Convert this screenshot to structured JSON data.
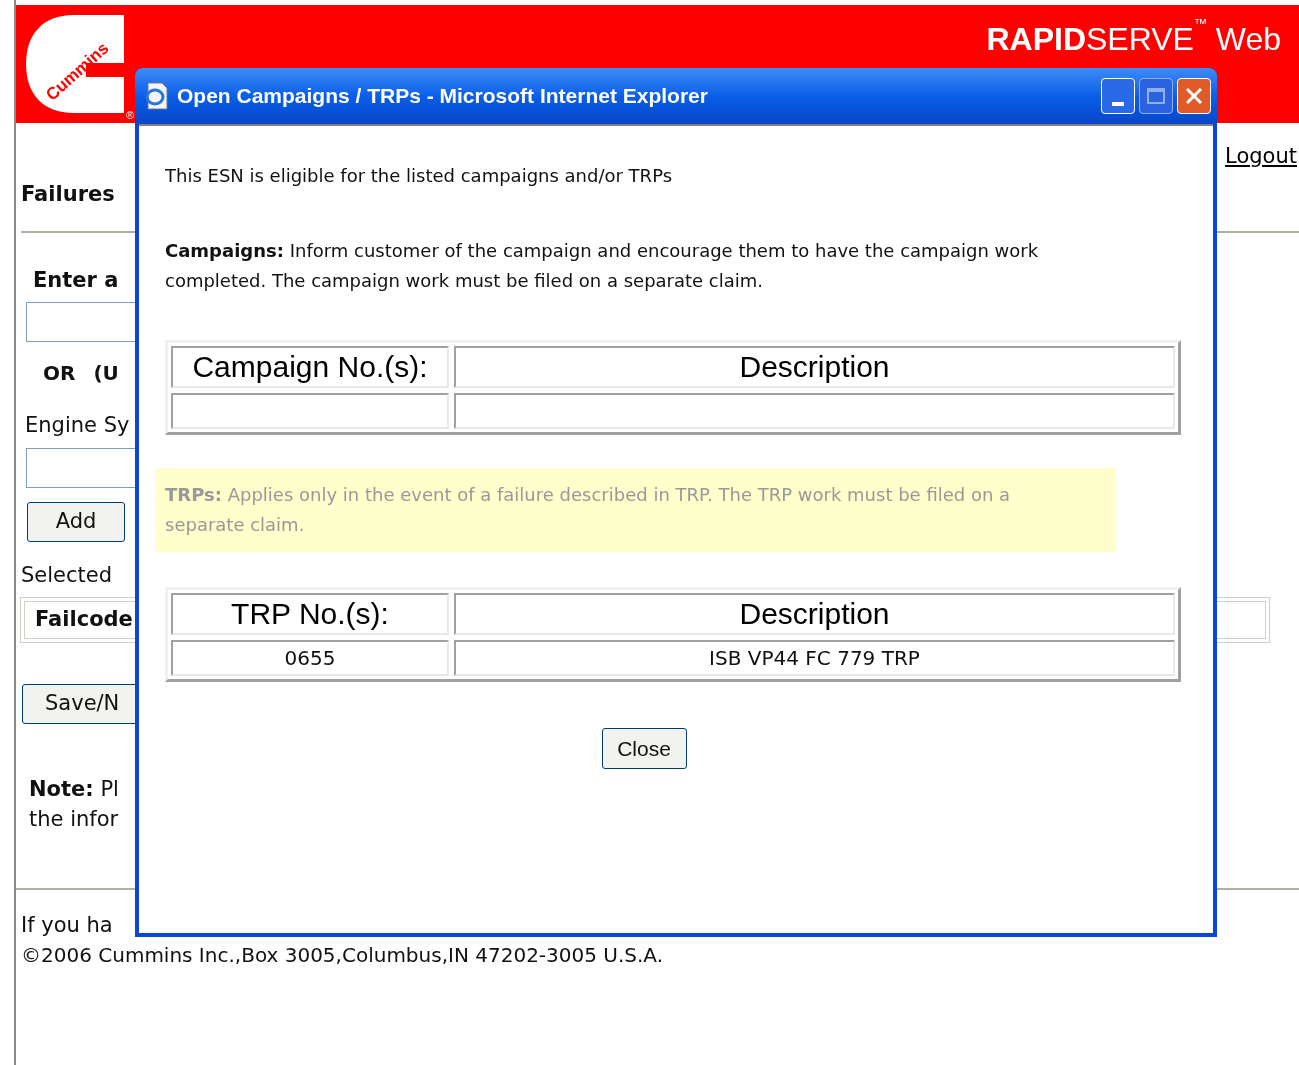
{
  "header": {
    "logo_text": "Cummins",
    "registered": "®",
    "brand_bold": "RAPID",
    "brand_rest": "SERVE",
    "trademark": "™",
    "brand_suffix": "Web"
  },
  "logout": "Logout",
  "page": {
    "heading": "Failures",
    "enter_label": "Enter a",
    "or_label": "OR",
    "or_hint": "(U",
    "engine_label": "Engine Sy",
    "add_button": "Add",
    "selected_label": "Selected",
    "failcode_header": "Failcode",
    "save_button": "Save/N",
    "note_bold": "Note:",
    "note_text": "Pl",
    "note_line2": "the infor"
  },
  "footer": {
    "line1": "If you ha",
    "copyright": "©2006 Cummins Inc.,Box 3005,Columbus,IN 47202-3005 U.S.A."
  },
  "dialog": {
    "title": "Open Campaigns / TRPs - Microsoft Internet Explorer",
    "intro": "This ESN is eligible for the listed campaigns and/or TRPs",
    "campaigns_note": "**Campaigns:** Inform customer of the campaign and encourage them to have the campaign work completed. The campaign work must be filed on a separate claim.",
    "campaigns_table": {
      "columns": [
        "Campaign No.(s):",
        "Description"
      ],
      "rows": [
        [
          "",
          ""
        ]
      ]
    },
    "trps_note": "**TRPs:** Applies only in the event of a failure described in TRP. The TRP work must be filed on a separate claim.",
    "trps_table": {
      "columns": [
        "TRP No.(s):",
        "Description"
      ],
      "rows": [
        [
          "0655",
          "ISB VP44 FC 779 TRP"
        ]
      ]
    },
    "close_button": "Close"
  }
}
